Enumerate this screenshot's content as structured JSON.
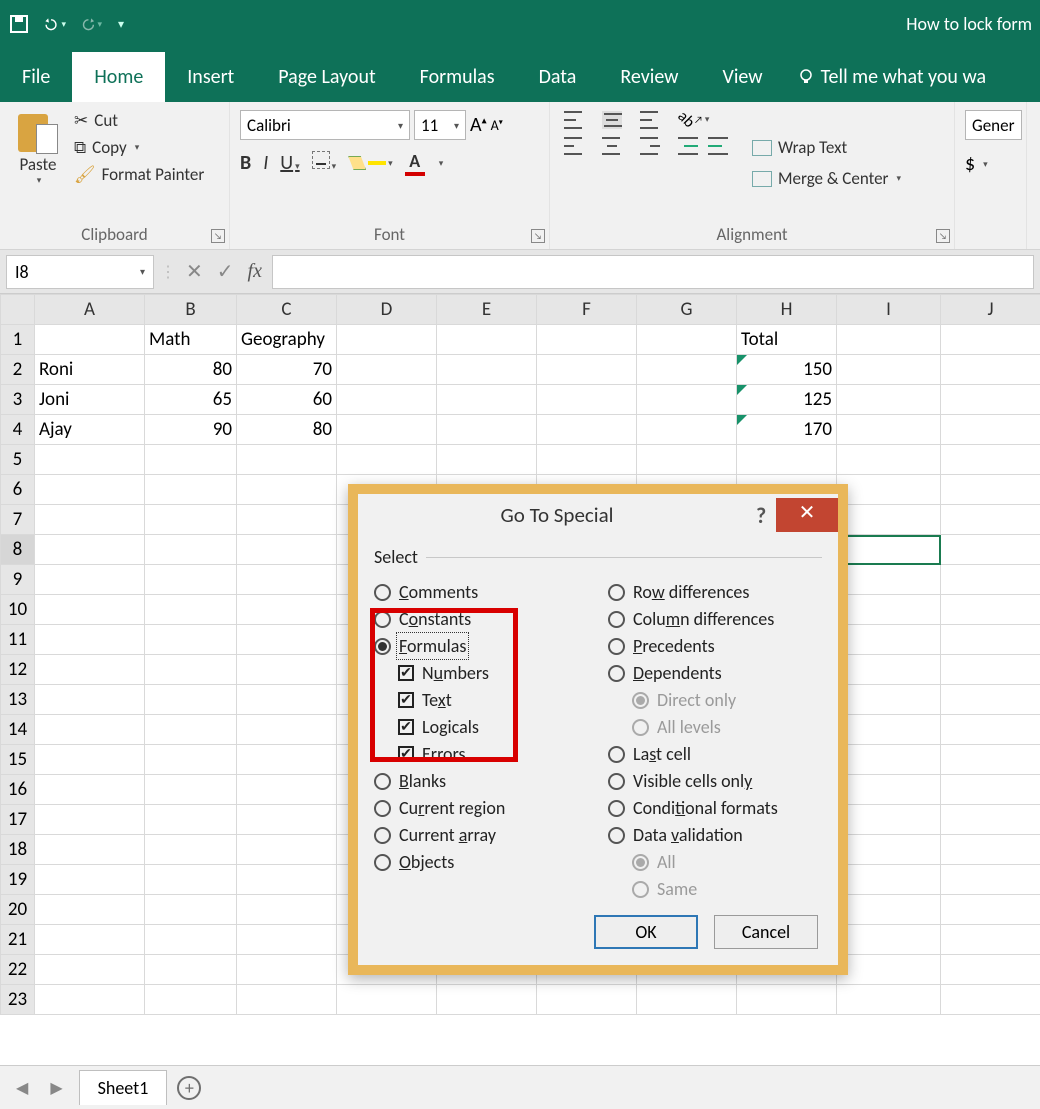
{
  "titlebar": {
    "doc_title": "How to lock form"
  },
  "tabs": {
    "file": "File",
    "home": "Home",
    "insert": "Insert",
    "page_layout": "Page Layout",
    "formulas": "Formulas",
    "data": "Data",
    "review": "Review",
    "view": "View",
    "tellme": "Tell me what you wa"
  },
  "ribbon": {
    "clipboard": {
      "label": "Clipboard",
      "paste": "Paste",
      "cut": "Cut",
      "copy": "Copy",
      "format_painter": "Format Painter"
    },
    "font": {
      "label": "Font",
      "name": "Calibri",
      "size": "11",
      "bold": "B",
      "italic": "I",
      "underline": "U"
    },
    "alignment": {
      "label": "Alignment",
      "wrap": "Wrap Text",
      "merge": "Merge & Center"
    },
    "number": {
      "label": "",
      "format": "Gener",
      "dollar": "$"
    }
  },
  "namebox": "I8",
  "fx_label": "fx",
  "columns": [
    "A",
    "B",
    "C",
    "D",
    "E",
    "F",
    "G",
    "H",
    "I",
    "J"
  ],
  "rows": [
    "1",
    "2",
    "3",
    "4",
    "5",
    "6",
    "7",
    "8",
    "9",
    "10",
    "11",
    "12",
    "13",
    "14",
    "15",
    "16",
    "17",
    "18",
    "19",
    "20",
    "21",
    "22",
    "23"
  ],
  "cells": {
    "B1": "Math",
    "C1": "Geography",
    "H1": "Total",
    "A2": "Roni",
    "B2": "80",
    "C2": "70",
    "H2": "150",
    "A3": "Joni",
    "B3": "65",
    "C3": "60",
    "H3": "125",
    "A4": "Ajay",
    "B4": "90",
    "C4": "80",
    "H4": "170"
  },
  "selected_cell": "I8",
  "sheets": {
    "active": "Sheet1"
  },
  "dialog": {
    "title": "Go To Special",
    "section": "Select",
    "left": [
      {
        "type": "radio",
        "label": "Comments",
        "u": "C",
        "sel": false
      },
      {
        "type": "radio",
        "label": "Constants",
        "u": "o",
        "sel": false
      },
      {
        "type": "radio",
        "label": "Formulas",
        "u": "F",
        "sel": true,
        "focus": true
      },
      {
        "type": "check",
        "label": "Numbers",
        "u": "u",
        "sel": true,
        "sub": true
      },
      {
        "type": "check",
        "label": "Text",
        "u": "x",
        "sel": true,
        "sub": true
      },
      {
        "type": "check",
        "label": "Logicals",
        "u": "g",
        "sel": true,
        "sub": true
      },
      {
        "type": "check",
        "label": "Errors",
        "u": "E",
        "sel": true,
        "sub": true
      },
      {
        "type": "radio",
        "label": "Blanks",
        "u": "B",
        "sel": false
      },
      {
        "type": "radio",
        "label": "Current region",
        "u": "r",
        "sel": false
      },
      {
        "type": "radio",
        "label": "Current array",
        "u": "a",
        "sel": false
      },
      {
        "type": "radio",
        "label": "Objects",
        "u": "O",
        "sel": false
      }
    ],
    "right": [
      {
        "type": "radio",
        "label": "Row differences",
        "u": "w",
        "sel": false
      },
      {
        "type": "radio",
        "label": "Column differences",
        "u": "m",
        "sel": false
      },
      {
        "type": "radio",
        "label": "Precedents",
        "u": "P",
        "sel": false
      },
      {
        "type": "radio",
        "label": "Dependents",
        "u": "D",
        "sel": false
      },
      {
        "type": "radio",
        "label": "Direct only",
        "u": "",
        "sel": true,
        "sub": true,
        "disabled": true
      },
      {
        "type": "radio",
        "label": "All levels",
        "u": "",
        "sel": false,
        "sub": true,
        "disabled": true
      },
      {
        "type": "radio",
        "label": "Last cell",
        "u": "s",
        "sel": false
      },
      {
        "type": "radio",
        "label": "Visible cells only",
        "u": "y",
        "sel": false
      },
      {
        "type": "radio",
        "label": "Conditional formats",
        "u": "t",
        "sel": false
      },
      {
        "type": "radio",
        "label": "Data validation",
        "u": "v",
        "sel": false
      },
      {
        "type": "radio",
        "label": "All",
        "u": "",
        "sel": true,
        "sub": true,
        "disabled": true
      },
      {
        "type": "radio",
        "label": "Same",
        "u": "",
        "sel": false,
        "sub": true,
        "disabled": true
      }
    ],
    "ok": "OK",
    "cancel": "Cancel"
  }
}
